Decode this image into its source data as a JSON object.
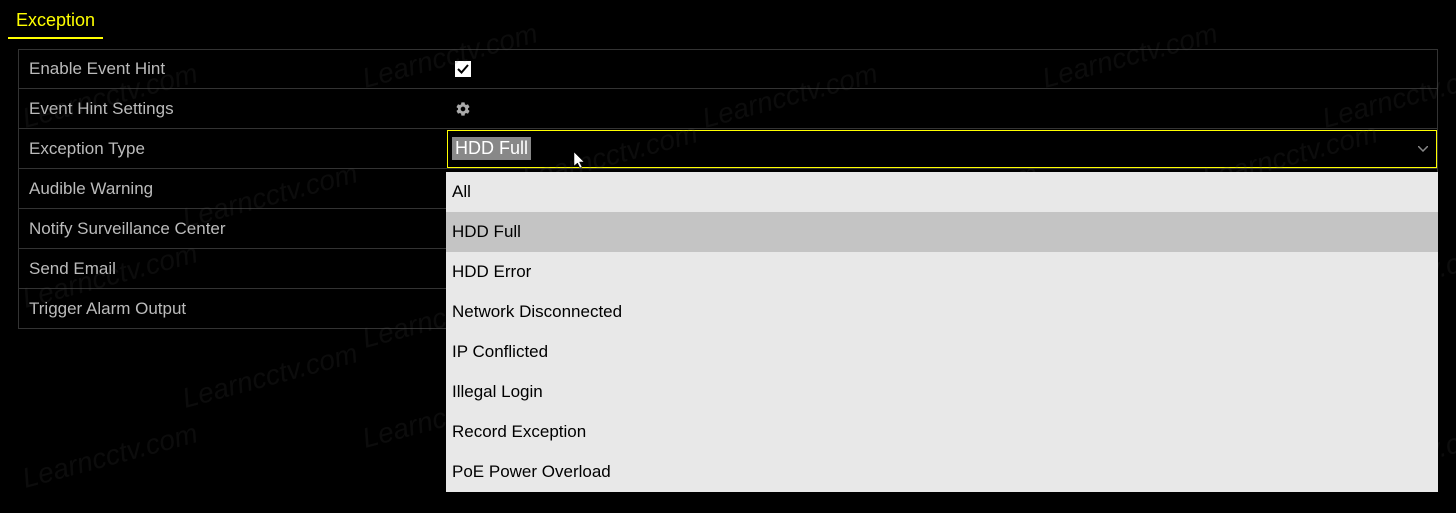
{
  "page_title": "Exception",
  "rows": {
    "enable_event_hint": "Enable Event Hint",
    "event_hint_settings": "Event Hint Settings",
    "exception_type": "Exception Type",
    "audible_warning": "Audible Warning",
    "notify_surveillance": "Notify Surveillance Center",
    "send_email": "Send Email",
    "trigger_alarm": "Trigger Alarm Output"
  },
  "checkbox_checked": true,
  "select": {
    "value": "HDD Full",
    "options": [
      "All",
      "HDD Full",
      "HDD Error",
      "Network Disconnected",
      "IP Conflicted",
      "Illegal Login",
      "Record Exception",
      "PoE Power Overload"
    ],
    "selected_index": 1
  },
  "watermark_text": "Learncctv.com"
}
